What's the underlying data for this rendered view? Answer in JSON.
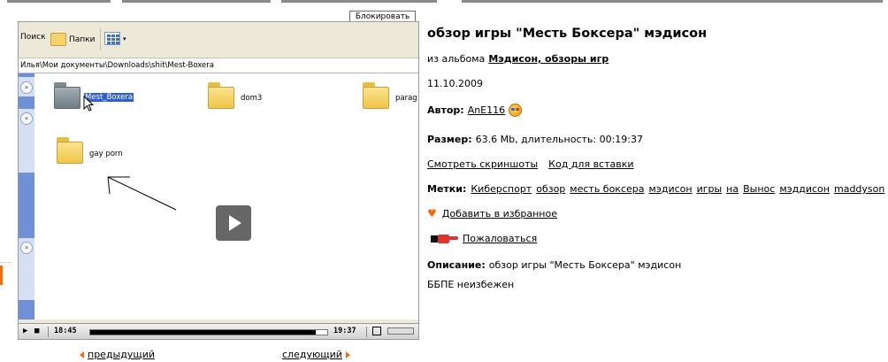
{
  "video": {
    "block_label": "Блокировать",
    "toolbar": {
      "search_label": "Поиск",
      "folders_label": "Папки"
    },
    "address": "Илья\\Мои документы\\Downloads\\shit\\Mest-Boxera",
    "folders": [
      {
        "label": "Mest_Boxera"
      },
      {
        "label": "dom3"
      },
      {
        "label": "parag"
      },
      {
        "label": "gay porn"
      }
    ],
    "player": {
      "time_current": "18:45",
      "time_total": "19:37",
      "progress_fraction": 0.95
    }
  },
  "nav": {
    "prev": "предыдущий",
    "next": "следующий"
  },
  "info": {
    "title": "обзор игры \"Месть Боксера\" мэдисон",
    "album_prefix": "из альбома",
    "album_name": "Мэдисон, обзоры игр",
    "date": "11.10.2009",
    "author_label": "Автор:",
    "author_name": "AnE116",
    "size_label": "Размер:",
    "size_value": "63.6 Mb, длительность: 00:19:37",
    "screenshots_link": "Смотреть скриншоты",
    "embed_link": "Код для вставки",
    "tags_label": "Метки:",
    "tags": [
      "Киберспорт",
      "обзор",
      "месть боксера",
      "мэдисон",
      "игры",
      "на",
      "Вынос",
      "мэддисон",
      "maddyson"
    ],
    "favorite_link": "Добавить в избранное",
    "complain_link": "Пожаловаться",
    "description_label": "Описание:",
    "description_value": "обзор игры \"Месть Боксера\" мэдисон",
    "description_extra": "ББПЕ неизбежен"
  },
  "colors": {
    "accent": "#f26d12",
    "selection": "#2f5fcf"
  }
}
